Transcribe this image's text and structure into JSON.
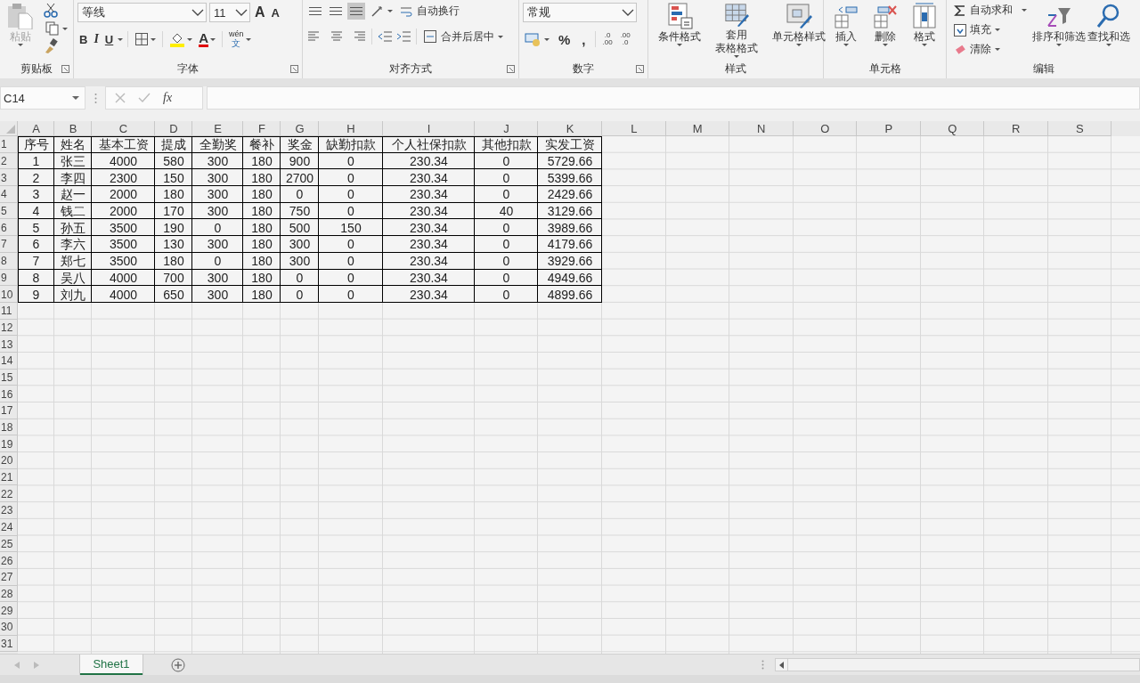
{
  "ribbon": {
    "groups": [
      {
        "kind": "clipboard",
        "label": "剪贴板",
        "paste": {
          "label": "粘贴",
          "disabled": true
        }
      },
      {
        "kind": "font",
        "label": "字体",
        "font_name": "等线",
        "font_size": "11",
        "grow_font": "A",
        "shrink_font": "A",
        "bold": "B",
        "italic": "I",
        "underline": "U",
        "font_color": "A",
        "phonetic": "wén",
        "phonetic_char": "文"
      },
      {
        "kind": "alignment",
        "label": "对齐方式",
        "vertical_align": [
          {
            "selected": false
          },
          {
            "selected": false
          },
          {
            "selected": true
          }
        ],
        "wrap_text": "自动换行",
        "merge_center": "合并后居中"
      },
      {
        "kind": "number",
        "label": "数字",
        "format": "常规",
        "percent": "%",
        "comma": ",",
        "increase_decimal": [
          ".0",
          ".00"
        ],
        "decrease_decimal": [
          ".00",
          ".0"
        ]
      },
      {
        "kind": "styles",
        "label": "样式",
        "buttons": [
          [
            "条件格式"
          ],
          [
            "套用",
            "表格格式"
          ],
          [
            "单元格样式"
          ]
        ]
      },
      {
        "kind": "cells",
        "label": "单元格",
        "buttons": [
          "插入",
          "删除",
          "格式"
        ]
      },
      {
        "kind": "editing",
        "label": "编辑",
        "autosum": "自动求和",
        "fill": "填充",
        "clear": "清除",
        "buttons": [
          "排序和筛选",
          "查找和选"
        ]
      }
    ]
  },
  "formula_bar": {
    "name_box": "C14",
    "function": "fx"
  },
  "sheet": {
    "columns": [
      "A",
      "B",
      "C",
      "D",
      "E",
      "F",
      "G",
      "H",
      "I",
      "J",
      "K",
      "L",
      "M",
      "N",
      "O",
      "P",
      "Q",
      "R",
      "S"
    ],
    "row_numbers": [
      "1",
      "2",
      "3",
      "4",
      "5",
      "6",
      "7",
      "8",
      "9",
      "10",
      "11",
      "12",
      "13",
      "14",
      "15",
      "16",
      "17",
      "18",
      "19",
      "20",
      "21",
      "22",
      "23",
      "24",
      "25",
      "26",
      "27",
      "28",
      "29",
      "30",
      "31"
    ],
    "rows": [
      [
        "序号",
        "姓名",
        "基本工资",
        "提成",
        "全勤奖",
        "餐补",
        "奖金",
        "缺勤扣款",
        "个人社保扣款",
        "其他扣款",
        "实发工资"
      ],
      [
        "1",
        "张三",
        "4000",
        "580",
        "300",
        "180",
        "900",
        "0",
        "230.34",
        "0",
        "5729.66"
      ],
      [
        "2",
        "李四",
        "2300",
        "150",
        "300",
        "180",
        "2700",
        "0",
        "230.34",
        "0",
        "5399.66"
      ],
      [
        "3",
        "赵一",
        "2000",
        "180",
        "300",
        "180",
        "0",
        "0",
        "230.34",
        "0",
        "2429.66"
      ],
      [
        "4",
        "钱二",
        "2000",
        "170",
        "300",
        "180",
        "750",
        "0",
        "230.34",
        "40",
        "3129.66"
      ],
      [
        "5",
        "孙五",
        "3500",
        "190",
        "0",
        "180",
        "500",
        "150",
        "230.34",
        "0",
        "3989.66"
      ],
      [
        "6",
        "李六",
        "3500",
        "130",
        "300",
        "180",
        "300",
        "0",
        "230.34",
        "0",
        "4179.66"
      ],
      [
        "7",
        "郑七",
        "3500",
        "180",
        "0",
        "180",
        "300",
        "0",
        "230.34",
        "0",
        "3929.66"
      ],
      [
        "8",
        "吴八",
        "4000",
        "700",
        "300",
        "180",
        "0",
        "0",
        "230.34",
        "0",
        "4949.66"
      ],
      [
        "9",
        "刘九",
        "4000",
        "650",
        "300",
        "180",
        "0",
        "0",
        "230.34",
        "0",
        "4899.66"
      ]
    ]
  },
  "sheet_tabs": [
    {
      "label": "Sheet1",
      "selected": true
    }
  ]
}
